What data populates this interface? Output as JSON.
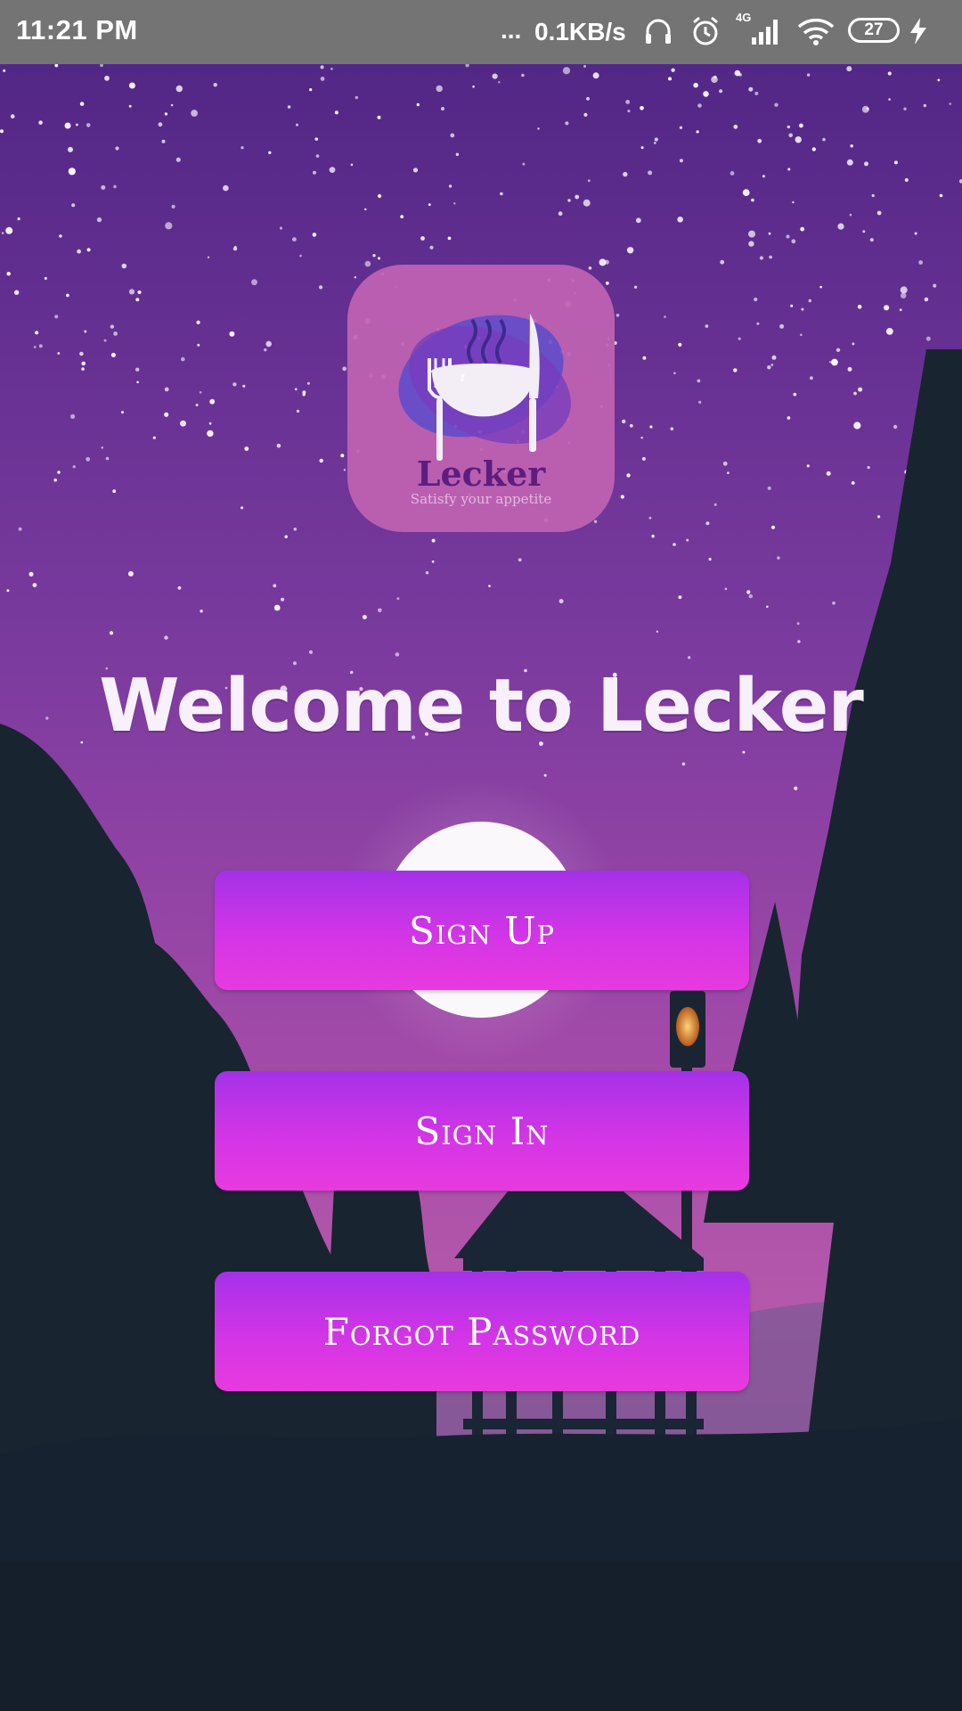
{
  "status_bar": {
    "time": "11:21 PM",
    "dots": "...",
    "net_speed": "0.1KB/s",
    "network_type": "4G",
    "battery_level": "27",
    "icons": [
      "headphones-icon",
      "alarm-icon",
      "signal-icon",
      "wifi-icon",
      "battery-icon",
      "charging-icon"
    ]
  },
  "logo": {
    "brand": "Lecker",
    "tagline": "Satisfy your appetite"
  },
  "welcome": {
    "title": "Welcome to Lecker"
  },
  "buttons": {
    "sign_up": "Sign Up",
    "sign_in": "Sign In",
    "forgot_password": "Forgot Password"
  },
  "colors": {
    "status_bar": "#747474",
    "sky_top": "#5a2a8f",
    "sky_bottom": "#b04fb1",
    "silhouette": "#172230",
    "button_top": "#a431e8",
    "button_bottom": "#e83ade",
    "logo_bg": "#c163b3"
  }
}
